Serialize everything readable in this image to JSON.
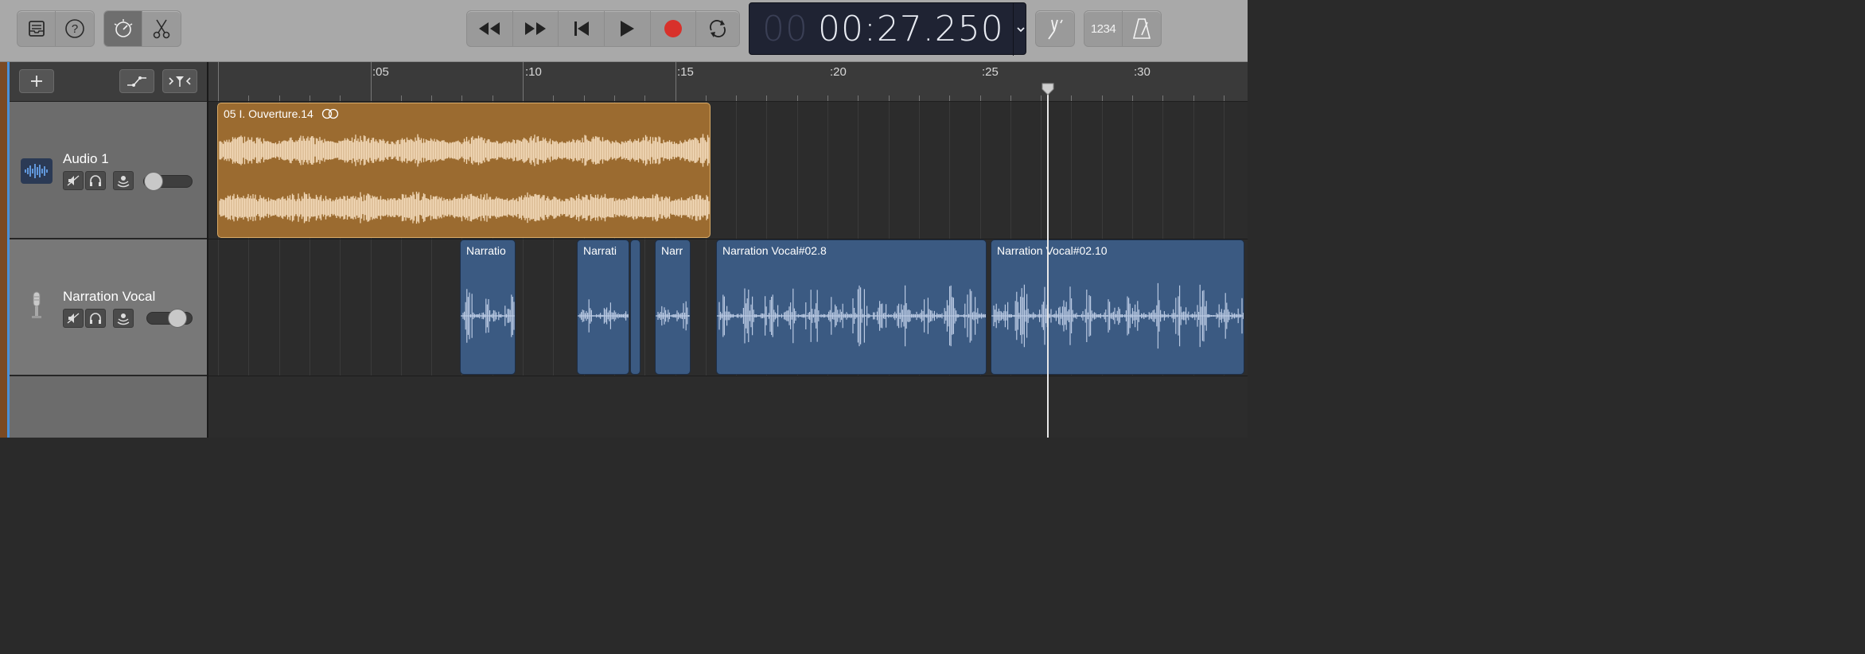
{
  "toolbar": {
    "library_icon": "library-icon",
    "help_icon": "help-icon",
    "smart_controls_icon": "smart-controls-icon",
    "editors_icon": "scissors-icon",
    "transport": [
      "rewind-icon",
      "fast-forward-icon",
      "go-to-beginning-icon",
      "play-icon",
      "record-icon",
      "cycle-icon"
    ],
    "record_color": "#d8312b",
    "lcd": {
      "dim_prefix": "00",
      "time": "00:27.250"
    },
    "tuner_icon": "tuner-icon",
    "count_in_label": "1234",
    "metronome_icon": "metronome-icon"
  },
  "track_header_controls": {
    "add_track_icon": "plus-icon",
    "automation_icon": "automation-icon",
    "catch_icon": "catch-playhead-icon"
  },
  "ruler": {
    "labels": [
      ":05",
      ":10",
      ":15",
      ":20",
      ":25",
      ":30"
    ]
  },
  "tracks": [
    {
      "name": "Audio 1",
      "icon": "waveform-icon",
      "volume": 0.0,
      "controls": [
        "mute-icon",
        "solo-headphones-icon",
        "record-enable-icon"
      ],
      "color": "#9b6b30"
    },
    {
      "name": "Narration Vocal",
      "icon": "microphone-icon",
      "volume": 0.75,
      "controls": [
        "mute-icon",
        "solo-headphones-icon",
        "record-enable-icon"
      ],
      "color": "#3b5a82"
    }
  ],
  "regions": {
    "audio": [
      {
        "label": "05 I. Ouverture.14",
        "loop_icon": "loop-icon"
      }
    ],
    "voice": [
      {
        "label": "Narratio"
      },
      {
        "label": "Narrati"
      },
      {
        "label": ""
      },
      {
        "label": "Narr"
      },
      {
        "label": "Narration Vocal#02.8"
      },
      {
        "label": "Narration Vocal#02.10"
      }
    ]
  },
  "playhead": {
    "time": "00:27.250"
  }
}
